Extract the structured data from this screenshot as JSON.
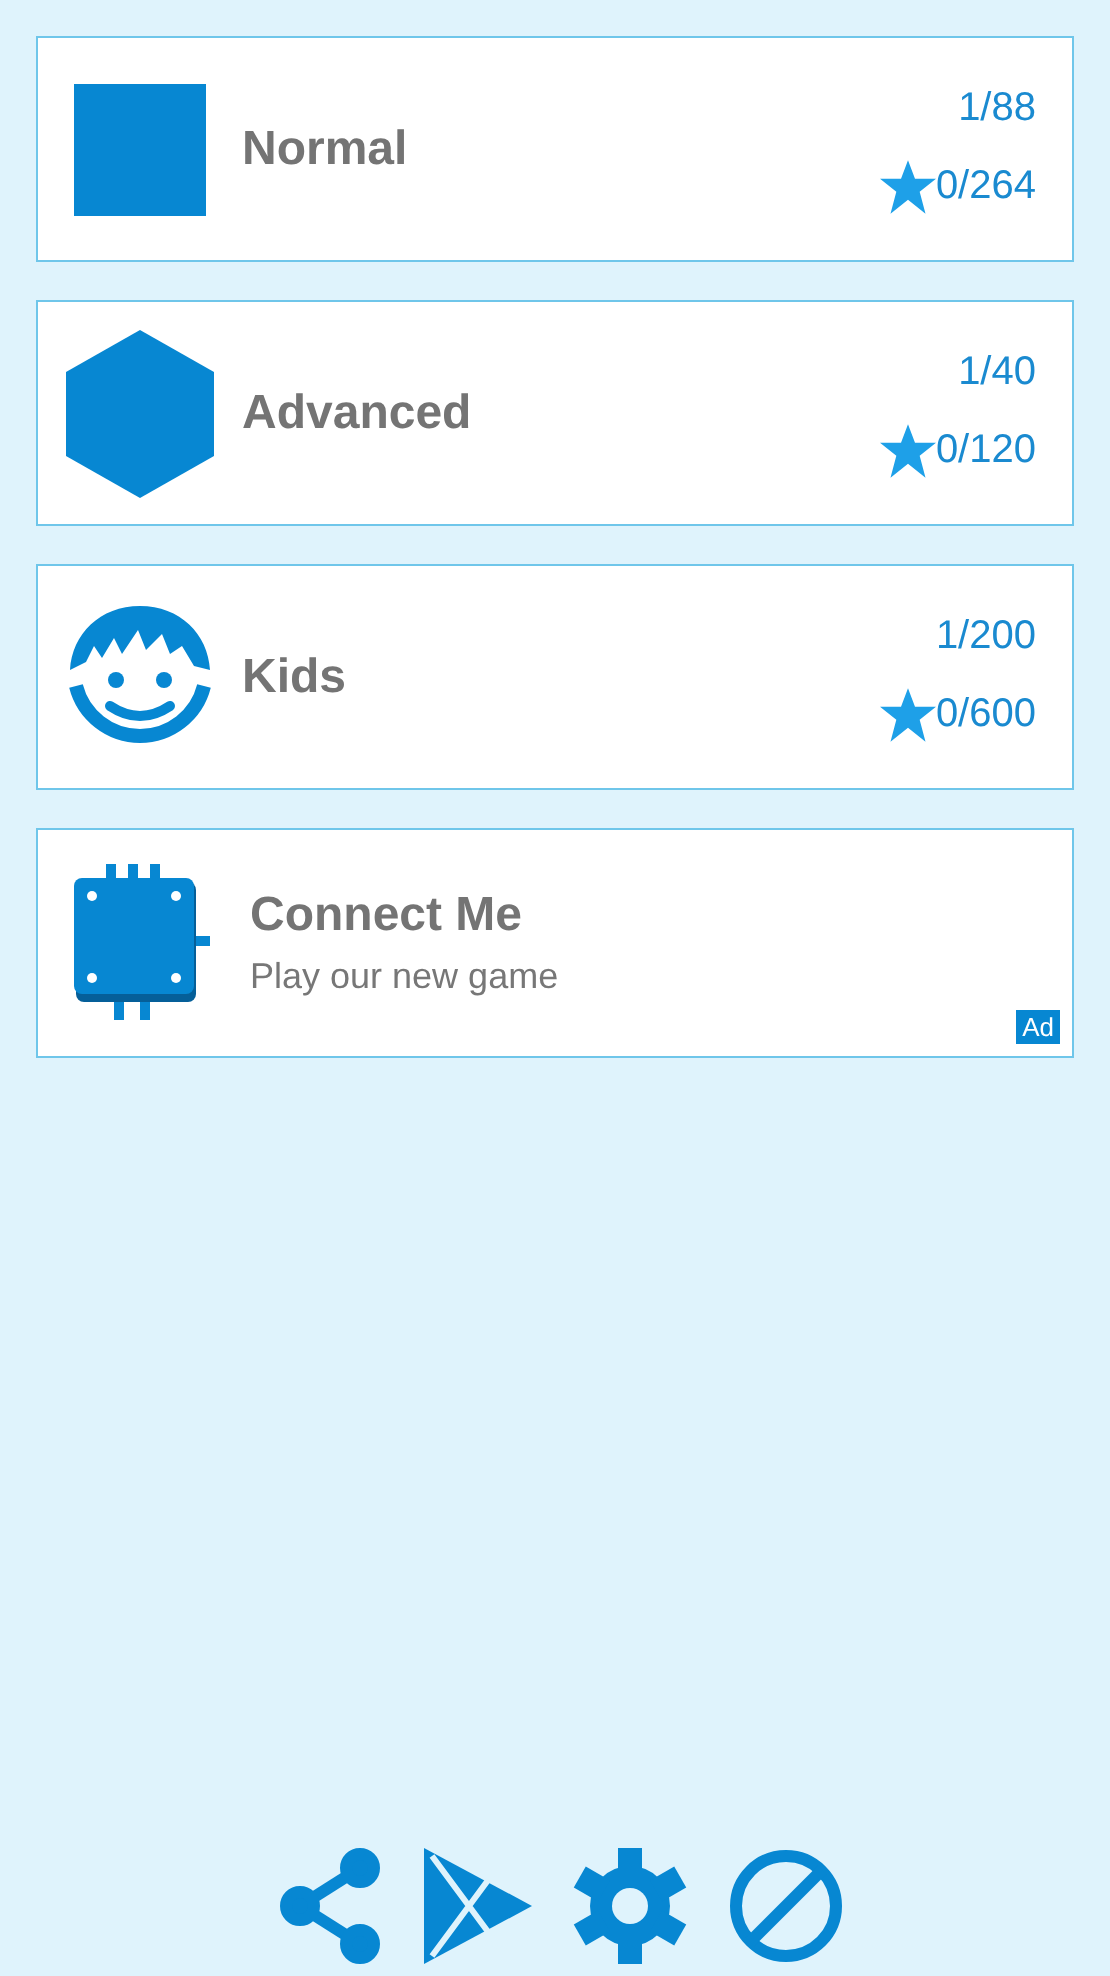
{
  "levels": [
    {
      "kind": "square",
      "title": "Normal",
      "progress": "1/88",
      "stars": "0/264"
    },
    {
      "kind": "hexagon",
      "title": "Advanced",
      "progress": "1/40",
      "stars": "0/120"
    },
    {
      "kind": "face",
      "title": "Kids",
      "progress": "1/200",
      "stars": "0/600"
    }
  ],
  "ad": {
    "title": "Connect Me",
    "subtitle": "Play our new game",
    "badge": "Ad"
  },
  "toolbar": [
    {
      "kind": "share"
    },
    {
      "kind": "store"
    },
    {
      "kind": "settings"
    },
    {
      "kind": "noads"
    }
  ]
}
